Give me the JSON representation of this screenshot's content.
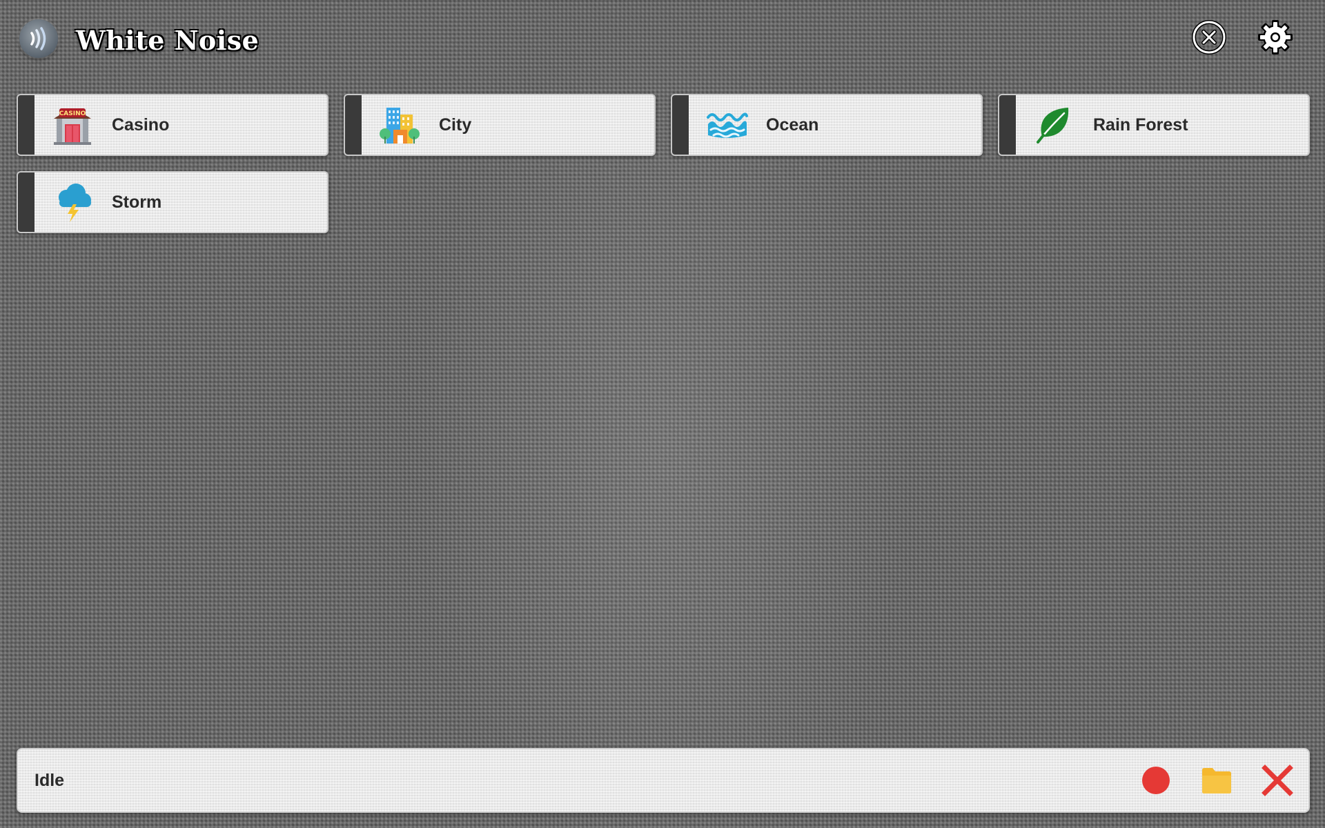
{
  "app": {
    "title": "White Noise",
    "logo_icon": "sound-waves-icon"
  },
  "header": {
    "close_icon": "close-circle-icon",
    "settings_icon": "gear-icon"
  },
  "sounds": [
    {
      "label": "Casino",
      "icon": "casino-icon"
    },
    {
      "label": "City",
      "icon": "city-buildings-icon"
    },
    {
      "label": "Ocean",
      "icon": "ocean-waves-icon"
    },
    {
      "label": "Rain Forest",
      "icon": "leaf-icon"
    },
    {
      "label": "Storm",
      "icon": "storm-cloud-icon"
    }
  ],
  "status_bar": {
    "status": "Idle",
    "record_icon": "record-icon",
    "folder_icon": "folder-icon",
    "stop_icon": "stop-x-icon",
    "colors": {
      "record": "#e53935",
      "folder": "#f5b82e",
      "stop": "#e53935"
    }
  },
  "colors": {
    "card_bg": "#e8e8e8",
    "card_stripe": "#3a3a3a",
    "text": "#2a2a2a"
  }
}
